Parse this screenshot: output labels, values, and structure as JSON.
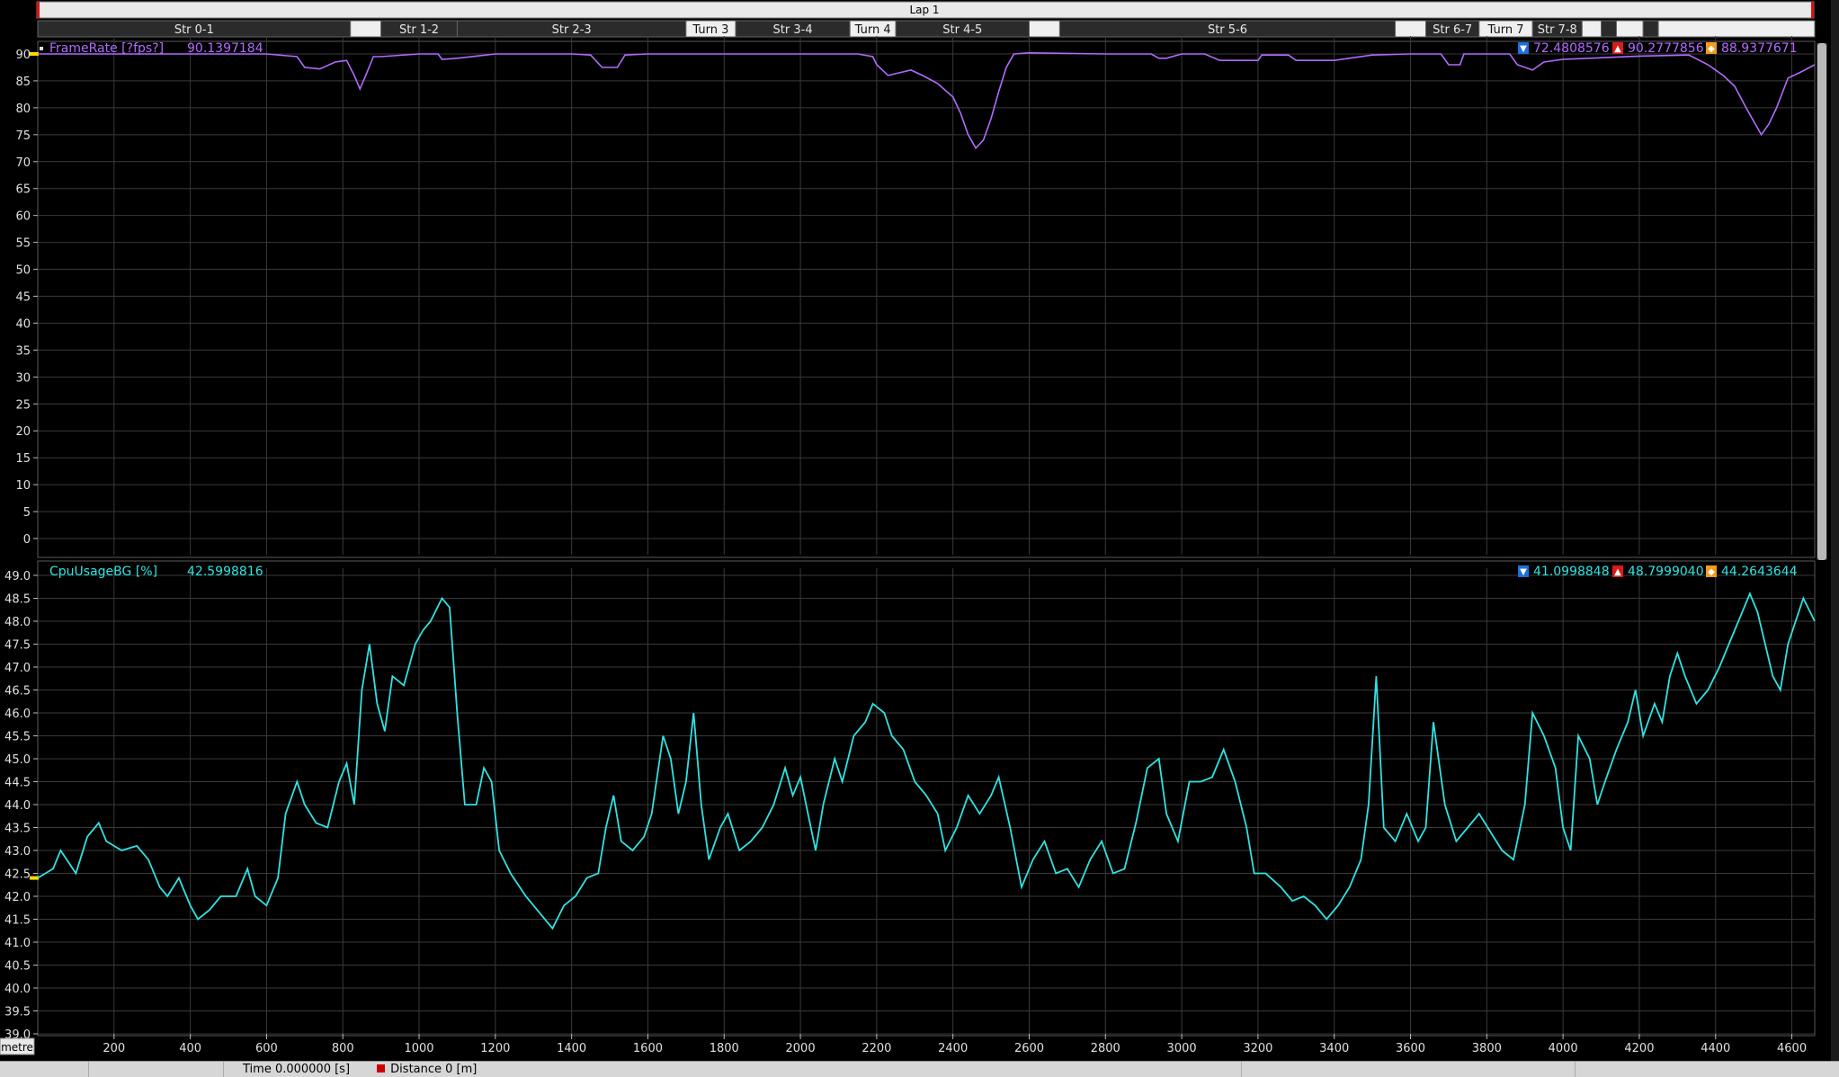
{
  "lap_label": "Lap 1",
  "segments": [
    {
      "label": "Str 0-1",
      "start": 0,
      "end": 820,
      "style": "dark"
    },
    {
      "label": "",
      "start": 820,
      "end": 900,
      "style": "light"
    },
    {
      "label": "Str 1-2",
      "start": 900,
      "end": 1100,
      "style": "dark"
    },
    {
      "label": "Str 2-3",
      "start": 1100,
      "end": 1700,
      "style": "dark"
    },
    {
      "label": "Turn 3",
      "start": 1700,
      "end": 1830,
      "style": "light"
    },
    {
      "label": "Str 3-4",
      "start": 1830,
      "end": 2130,
      "style": "dark"
    },
    {
      "label": "Turn 4",
      "start": 2130,
      "end": 2250,
      "style": "light"
    },
    {
      "label": "Str 4-5",
      "start": 2250,
      "end": 2600,
      "style": "dark"
    },
    {
      "label": "",
      "start": 2600,
      "end": 2680,
      "style": "light"
    },
    {
      "label": "Str 5-6",
      "start": 2680,
      "end": 3560,
      "style": "dark"
    },
    {
      "label": "",
      "start": 3560,
      "end": 3640,
      "style": "light"
    },
    {
      "label": "Str 6-7",
      "start": 3640,
      "end": 3780,
      "style": "dark"
    },
    {
      "label": "Turn 7",
      "start": 3780,
      "end": 3920,
      "style": "light"
    },
    {
      "label": "Str 7-8",
      "start": 3920,
      "end": 4050,
      "style": "dark"
    },
    {
      "label": "",
      "start": 4050,
      "end": 4100,
      "style": "light"
    },
    {
      "label": "",
      "start": 4100,
      "end": 4140,
      "style": "dark"
    },
    {
      "label": "",
      "start": 4140,
      "end": 4210,
      "style": "light"
    },
    {
      "label": "",
      "start": 4210,
      "end": 4250,
      "style": "dark"
    },
    {
      "label": "",
      "start": 4250,
      "end": 4660,
      "style": "light"
    }
  ],
  "x_unit_label": "metre",
  "status": {
    "time": "Time  0.000000 [s]",
    "distance": "Distance  0 [m]"
  },
  "colors": {
    "framerate": "#b26bff",
    "cpu": "#2fe3e3",
    "grid": "#3a3a3a",
    "cursor": "#ffd800"
  },
  "chart_data": [
    {
      "type": "line",
      "name": "FrameRate [?fps?]",
      "current_value": "90.1397184",
      "stats": {
        "min": "72.4808576",
        "max": "90.2777856",
        "avg": "88.9377671"
      },
      "xlim": [
        0,
        4660
      ],
      "ylim": [
        -3,
        92
      ],
      "y_ticks": [
        0,
        5,
        10,
        15,
        20,
        25,
        30,
        35,
        40,
        45,
        50,
        55,
        60,
        65,
        70,
        75,
        80,
        85,
        90
      ],
      "points": [
        [
          0,
          90
        ],
        [
          300,
          90
        ],
        [
          600,
          90
        ],
        [
          680,
          89.5
        ],
        [
          700,
          87.5
        ],
        [
          740,
          87.2
        ],
        [
          780,
          88.5
        ],
        [
          810,
          88.8
        ],
        [
          830,
          86
        ],
        [
          845,
          83.5
        ],
        [
          860,
          86
        ],
        [
          880,
          89.5
        ],
        [
          900,
          89.5
        ],
        [
          1000,
          90
        ],
        [
          1050,
          90
        ],
        [
          1060,
          89
        ],
        [
          1100,
          89.2
        ],
        [
          1150,
          89.6
        ],
        [
          1200,
          90
        ],
        [
          1400,
          90
        ],
        [
          1450,
          89.8
        ],
        [
          1480,
          87.5
        ],
        [
          1520,
          87.5
        ],
        [
          1540,
          89.8
        ],
        [
          1600,
          90
        ],
        [
          1800,
          90
        ],
        [
          2000,
          90
        ],
        [
          2150,
          90
        ],
        [
          2190,
          89.5
        ],
        [
          2200,
          88
        ],
        [
          2230,
          86
        ],
        [
          2260,
          86.5
        ],
        [
          2290,
          87
        ],
        [
          2320,
          86
        ],
        [
          2360,
          84.5
        ],
        [
          2400,
          82
        ],
        [
          2420,
          79
        ],
        [
          2440,
          75
        ],
        [
          2460,
          72.5
        ],
        [
          2480,
          74
        ],
        [
          2500,
          78
        ],
        [
          2520,
          83
        ],
        [
          2540,
          87.5
        ],
        [
          2560,
          90
        ],
        [
          2600,
          90.2
        ],
        [
          2800,
          90
        ],
        [
          2920,
          90
        ],
        [
          2940,
          89.2
        ],
        [
          2960,
          89.2
        ],
        [
          3000,
          90
        ],
        [
          3060,
          90
        ],
        [
          3100,
          88.8
        ],
        [
          3200,
          88.8
        ],
        [
          3210,
          89.8
        ],
        [
          3280,
          89.8
        ],
        [
          3300,
          88.8
        ],
        [
          3400,
          88.8
        ],
        [
          3500,
          89.8
        ],
        [
          3600,
          90
        ],
        [
          3680,
          90
        ],
        [
          3700,
          88
        ],
        [
          3730,
          88
        ],
        [
          3740,
          90
        ],
        [
          3860,
          90
        ],
        [
          3880,
          88
        ],
        [
          3920,
          87
        ],
        [
          3950,
          88.5
        ],
        [
          4000,
          89
        ],
        [
          4200,
          89.6
        ],
        [
          4330,
          89.8
        ],
        [
          4380,
          88
        ],
        [
          4420,
          86
        ],
        [
          4450,
          84
        ],
        [
          4480,
          80
        ],
        [
          4520,
          75
        ],
        [
          4540,
          77
        ],
        [
          4560,
          80
        ],
        [
          4590,
          85.5
        ],
        [
          4620,
          86.5
        ],
        [
          4660,
          88
        ]
      ]
    },
    {
      "type": "line",
      "name": "CpuUsageBG [%]",
      "current_value": "42.5998816",
      "stats": {
        "min": "41.0998848",
        "max": "48.7999040",
        "avg": "44.2643644"
      },
      "xlim": [
        0,
        4660
      ],
      "ylim": [
        39.0,
        49.0
      ],
      "y_ticks": [
        39.0,
        39.5,
        40.0,
        40.5,
        41.0,
        41.5,
        42.0,
        42.5,
        43.0,
        43.5,
        44.0,
        44.5,
        45.0,
        45.5,
        46.0,
        46.5,
        47.0,
        47.5,
        48.0,
        48.5,
        49.0
      ],
      "x_ticks": [
        200,
        400,
        600,
        800,
        1000,
        1200,
        1400,
        1600,
        1800,
        2000,
        2200,
        2400,
        2600,
        2800,
        3000,
        3200,
        3400,
        3600,
        3800,
        4000,
        4200,
        4400,
        4600
      ],
      "points": [
        [
          0,
          42.4
        ],
        [
          40,
          42.6
        ],
        [
          60,
          43
        ],
        [
          100,
          42.5
        ],
        [
          130,
          43.3
        ],
        [
          160,
          43.6
        ],
        [
          180,
          43.2
        ],
        [
          220,
          43.0
        ],
        [
          260,
          43.1
        ],
        [
          290,
          42.8
        ],
        [
          320,
          42.2
        ],
        [
          340,
          42.0
        ],
        [
          370,
          42.4
        ],
        [
          400,
          41.8
        ],
        [
          420,
          41.5
        ],
        [
          450,
          41.7
        ],
        [
          480,
          42.0
        ],
        [
          520,
          42.0
        ],
        [
          550,
          42.6
        ],
        [
          570,
          42.0
        ],
        [
          600,
          41.8
        ],
        [
          630,
          42.4
        ],
        [
          650,
          43.8
        ],
        [
          680,
          44.5
        ],
        [
          700,
          44.0
        ],
        [
          730,
          43.6
        ],
        [
          760,
          43.5
        ],
        [
          790,
          44.5
        ],
        [
          810,
          44.9
        ],
        [
          830,
          44.0
        ],
        [
          850,
          46.5
        ],
        [
          870,
          47.5
        ],
        [
          890,
          46.2
        ],
        [
          910,
          45.6
        ],
        [
          930,
          46.8
        ],
        [
          960,
          46.6
        ],
        [
          990,
          47.5
        ],
        [
          1010,
          47.8
        ],
        [
          1030,
          48.0
        ],
        [
          1060,
          48.5
        ],
        [
          1080,
          48.3
        ],
        [
          1100,
          46.0
        ],
        [
          1120,
          44.0
        ],
        [
          1150,
          44.0
        ],
        [
          1170,
          44.8
        ],
        [
          1190,
          44.5
        ],
        [
          1210,
          43.0
        ],
        [
          1240,
          42.5
        ],
        [
          1280,
          42.0
        ],
        [
          1320,
          41.6
        ],
        [
          1350,
          41.3
        ],
        [
          1380,
          41.8
        ],
        [
          1410,
          42.0
        ],
        [
          1440,
          42.4
        ],
        [
          1470,
          42.5
        ],
        [
          1490,
          43.5
        ],
        [
          1510,
          44.2
        ],
        [
          1530,
          43.2
        ],
        [
          1560,
          43.0
        ],
        [
          1590,
          43.3
        ],
        [
          1610,
          43.8
        ],
        [
          1640,
          45.5
        ],
        [
          1660,
          45.0
        ],
        [
          1680,
          43.8
        ],
        [
          1700,
          44.5
        ],
        [
          1720,
          46.0
        ],
        [
          1740,
          44.0
        ],
        [
          1760,
          42.8
        ],
        [
          1790,
          43.5
        ],
        [
          1810,
          43.8
        ],
        [
          1840,
          43.0
        ],
        [
          1870,
          43.2
        ],
        [
          1900,
          43.5
        ],
        [
          1930,
          44.0
        ],
        [
          1960,
          44.8
        ],
        [
          1980,
          44.2
        ],
        [
          2000,
          44.6
        ],
        [
          2020,
          43.8
        ],
        [
          2040,
          43.0
        ],
        [
          2060,
          44.0
        ],
        [
          2090,
          45.0
        ],
        [
          2110,
          44.5
        ],
        [
          2140,
          45.5
        ],
        [
          2170,
          45.8
        ],
        [
          2190,
          46.2
        ],
        [
          2220,
          46.0
        ],
        [
          2240,
          45.5
        ],
        [
          2270,
          45.2
        ],
        [
          2300,
          44.5
        ],
        [
          2330,
          44.2
        ],
        [
          2360,
          43.8
        ],
        [
          2380,
          43.0
        ],
        [
          2410,
          43.5
        ],
        [
          2440,
          44.2
        ],
        [
          2470,
          43.8
        ],
        [
          2500,
          44.2
        ],
        [
          2520,
          44.6
        ],
        [
          2550,
          43.5
        ],
        [
          2580,
          42.2
        ],
        [
          2610,
          42.8
        ],
        [
          2640,
          43.2
        ],
        [
          2670,
          42.5
        ],
        [
          2700,
          42.6
        ],
        [
          2730,
          42.2
        ],
        [
          2760,
          42.8
        ],
        [
          2790,
          43.2
        ],
        [
          2820,
          42.5
        ],
        [
          2850,
          42.6
        ],
        [
          2880,
          43.6
        ],
        [
          2910,
          44.8
        ],
        [
          2940,
          45.0
        ],
        [
          2960,
          43.8
        ],
        [
          2990,
          43.2
        ],
        [
          3020,
          44.5
        ],
        [
          3050,
          44.5
        ],
        [
          3080,
          44.6
        ],
        [
          3110,
          45.2
        ],
        [
          3140,
          44.5
        ],
        [
          3170,
          43.5
        ],
        [
          3190,
          42.5
        ],
        [
          3220,
          42.5
        ],
        [
          3260,
          42.2
        ],
        [
          3290,
          41.9
        ],
        [
          3320,
          42.0
        ],
        [
          3350,
          41.8
        ],
        [
          3380,
          41.5
        ],
        [
          3410,
          41.8
        ],
        [
          3440,
          42.2
        ],
        [
          3470,
          42.8
        ],
        [
          3490,
          44.0
        ],
        [
          3510,
          46.8
        ],
        [
          3530,
          43.5
        ],
        [
          3560,
          43.2
        ],
        [
          3590,
          43.8
        ],
        [
          3620,
          43.2
        ],
        [
          3640,
          43.5
        ],
        [
          3660,
          45.8
        ],
        [
          3690,
          44.0
        ],
        [
          3720,
          43.2
        ],
        [
          3750,
          43.5
        ],
        [
          3780,
          43.8
        ],
        [
          3810,
          43.4
        ],
        [
          3840,
          43.0
        ],
        [
          3870,
          42.8
        ],
        [
          3900,
          44.0
        ],
        [
          3920,
          46.0
        ],
        [
          3950,
          45.5
        ],
        [
          3980,
          44.8
        ],
        [
          4000,
          43.5
        ],
        [
          4020,
          43.0
        ],
        [
          4040,
          45.5
        ],
        [
          4070,
          45.0
        ],
        [
          4090,
          44.0
        ],
        [
          4110,
          44.5
        ],
        [
          4140,
          45.2
        ],
        [
          4170,
          45.8
        ],
        [
          4190,
          46.5
        ],
        [
          4210,
          45.5
        ],
        [
          4240,
          46.2
        ],
        [
          4260,
          45.8
        ],
        [
          4280,
          46.8
        ],
        [
          4300,
          47.3
        ],
        [
          4320,
          46.8
        ],
        [
          4350,
          46.2
        ],
        [
          4380,
          46.5
        ],
        [
          4410,
          47.0
        ],
        [
          4440,
          47.6
        ],
        [
          4470,
          48.2
        ],
        [
          4490,
          48.6
        ],
        [
          4510,
          48.2
        ],
        [
          4530,
          47.5
        ],
        [
          4550,
          46.8
        ],
        [
          4570,
          46.5
        ],
        [
          4590,
          47.5
        ],
        [
          4610,
          48.0
        ],
        [
          4630,
          48.5
        ],
        [
          4660,
          48.0
        ]
      ]
    }
  ]
}
